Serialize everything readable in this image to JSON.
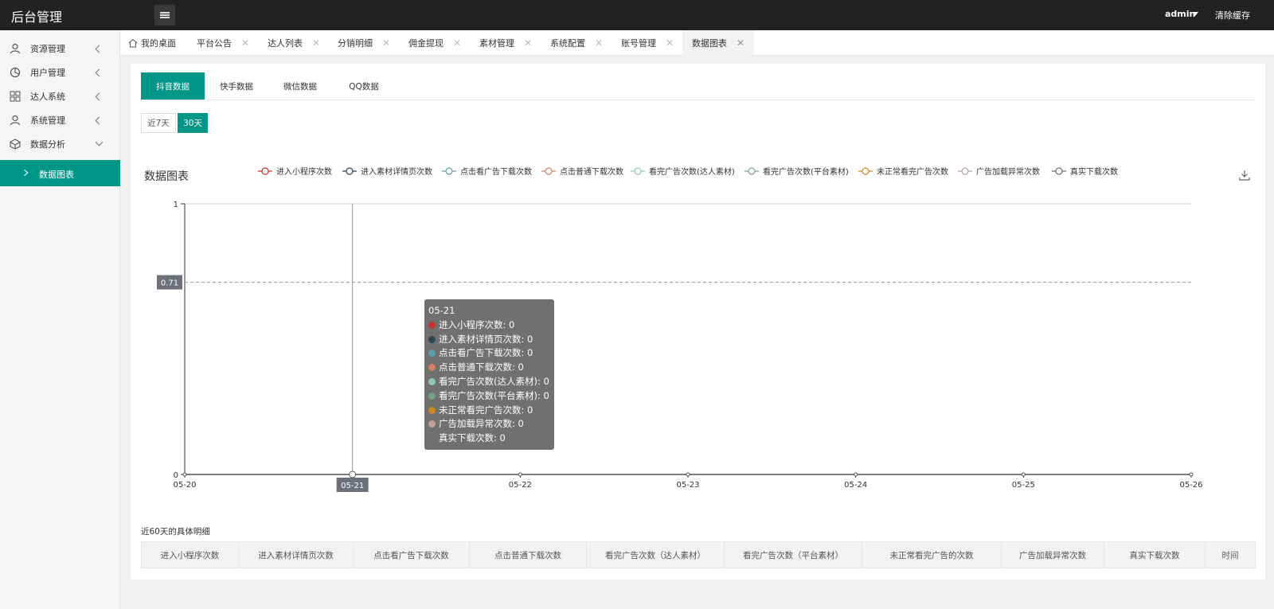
{
  "app": {
    "title": "后台管理",
    "user": "admin",
    "clear_cache": "清除缓存"
  },
  "sidebar": {
    "items": [
      {
        "label": "资源管理",
        "icon": "user-icon"
      },
      {
        "label": "用户管理",
        "icon": "pie-chart-icon"
      },
      {
        "label": "达人系统",
        "icon": "grid-icon"
      },
      {
        "label": "系统管理",
        "icon": "user-icon"
      },
      {
        "label": "数据分析",
        "icon": "cube-icon"
      }
    ],
    "active_sub": "数据图表"
  },
  "tabs": [
    {
      "label": "我的桌面"
    },
    {
      "label": "平台公告"
    },
    {
      "label": "达人列表"
    },
    {
      "label": "分销明细"
    },
    {
      "label": "佣金提现"
    },
    {
      "label": "素材管理"
    },
    {
      "label": "系统配置"
    },
    {
      "label": "账号管理"
    },
    {
      "label": "数据图表"
    }
  ],
  "platform_tabs": [
    "抖音数据",
    "快手数据",
    "微信数据",
    "QQ数据"
  ],
  "ranges": [
    "近7天",
    "30天"
  ],
  "chart": {
    "title": "数据图表",
    "y_marker": "0.71",
    "x_marker": "05-21"
  },
  "chart_data": {
    "type": "line",
    "x": [
      "05-20",
      "05-21",
      "05-22",
      "05-23",
      "05-24",
      "05-25",
      "05-26"
    ],
    "ylim": [
      0,
      1
    ],
    "yticks": [
      "0",
      "1"
    ],
    "legend_position": "top",
    "series": [
      {
        "name": "进入小程序次数",
        "color": "#c23531",
        "values": [
          0,
          0,
          0,
          0,
          0,
          0,
          0
        ]
      },
      {
        "name": "进入素材详情页次数",
        "color": "#2f4554",
        "values": [
          0,
          0,
          0,
          0,
          0,
          0,
          0
        ]
      },
      {
        "name": "点击看广告下载次数",
        "color": "#61a0a8",
        "values": [
          0,
          0,
          0,
          0,
          0,
          0,
          0
        ]
      },
      {
        "name": "点击普通下载次数",
        "color": "#d48265",
        "values": [
          0,
          0,
          0,
          0,
          0,
          0,
          0
        ]
      },
      {
        "name": "看完广告次数(达人素材)",
        "color": "#91c7ae",
        "values": [
          0,
          0,
          0,
          0,
          0,
          0,
          0
        ]
      },
      {
        "name": "看完广告次数(平台素材)",
        "color": "#749f83",
        "values": [
          0,
          0,
          0,
          0,
          0,
          0,
          0
        ]
      },
      {
        "name": "未正常看完广告次数",
        "color": "#ca8622",
        "values": [
          0,
          0,
          0,
          0,
          0,
          0,
          0
        ]
      },
      {
        "name": "广告加载异常次数",
        "color": "#bda29a",
        "values": [
          0,
          0,
          0,
          0,
          0,
          0,
          0
        ]
      },
      {
        "name": "真实下载次数",
        "color": "#6e7074",
        "values": [
          0,
          0,
          0,
          0,
          0,
          0,
          0
        ]
      }
    ]
  },
  "tooltip": {
    "date": "05-21",
    "rows": [
      {
        "text": "进入小程序次数: 0",
        "color": "#c23531"
      },
      {
        "text": "进入素材详情页次数: 0",
        "color": "#2f4554"
      },
      {
        "text": "点击看广告下载次数: 0",
        "color": "#61a0a8"
      },
      {
        "text": "点击普通下载次数: 0",
        "color": "#d48265"
      },
      {
        "text": "看完广告次数(达人素材): 0",
        "color": "#91c7ae"
      },
      {
        "text": "看完广告次数(平台素材): 0",
        "color": "#749f83"
      },
      {
        "text": "未正常看完广告次数: 0",
        "color": "#ca8622"
      },
      {
        "text": "广告加载异常次数: 0",
        "color": "#bda29a"
      },
      {
        "text": "真实下载次数: 0",
        "color": "#6e7074"
      }
    ]
  },
  "detail": {
    "title": "近60天的具体明细",
    "columns": [
      "进入小程序次数",
      "进入素材详情页次数",
      "点击看广告下载次数",
      "点击普通下载次数",
      "看完广告次数（达人素材）",
      "看完广告次数（平台素材）",
      "未正常看完广告的次数",
      "广告加载异常次数",
      "真实下载次数",
      "时间"
    ]
  },
  "colors": {
    "accent": "#009688",
    "topbar": "#222222"
  }
}
